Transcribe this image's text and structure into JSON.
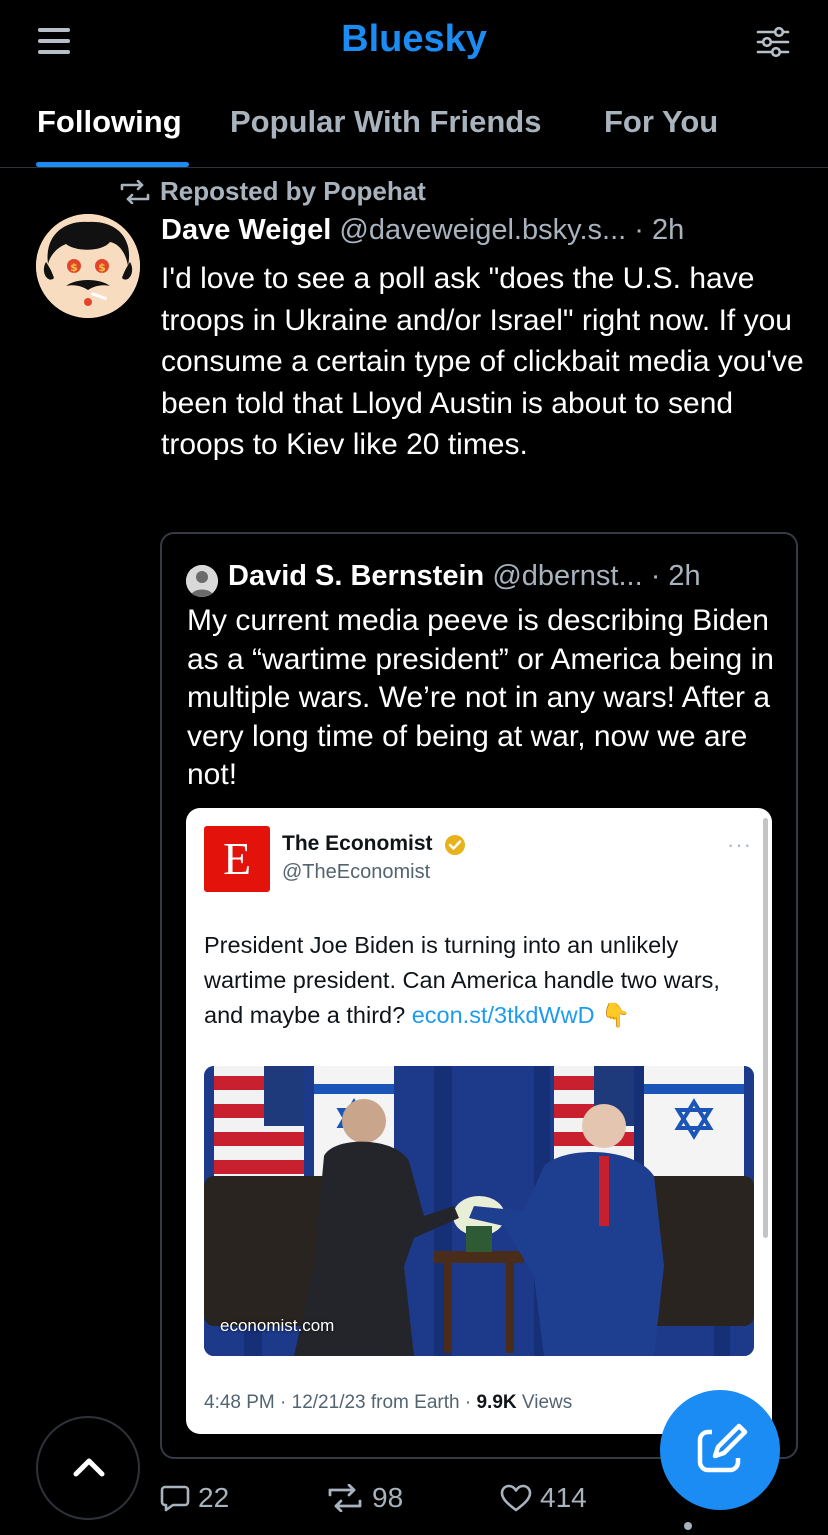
{
  "header": {
    "title": "Bluesky",
    "menu_icon": "hamburger-menu-icon",
    "filter_icon": "sliders-icon"
  },
  "tabs": [
    {
      "label": "Following",
      "active": true
    },
    {
      "label": "Popular With Friends",
      "active": false
    },
    {
      "label": "For You",
      "active": false
    }
  ],
  "post": {
    "repost_label": "Reposted by Popehat",
    "author_name": "Dave Weigel",
    "author_handle": "@daveweigel.bsky.s...",
    "time": "· 2h",
    "text": "I'd love to see a poll ask \"does the U.S. have troops in Ukraine and/or Israel\" right now. If you consume a certain type of clickbait media you've been told that Lloyd Austin is about to send troops to Kiev like 20 times.",
    "quote": {
      "author_name": "David S. Bernstein",
      "author_handle": "@dbernst...",
      "time": "· 2h",
      "text": "My current media peeve is describing Biden as a “wartime president” or America being in multiple wars. We’re not in any wars! After a very long time of being at war, now we are not!",
      "embed": {
        "logo_letter": "E",
        "name": "The Economist",
        "handle": "@TheEconomist",
        "more": "···",
        "text": "President Joe Biden is turning into an unlikely wartime president. Can America handle two wars, and maybe a third?",
        "link": "econ.st/3tkdWwD",
        "emoji": "👇",
        "photo_source": "economist.com",
        "footer_time": "4:48 PM · 12/21/23 from Earth · ",
        "footer_views": "9.9K",
        "footer_views_label": " Views"
      }
    },
    "actions": {
      "replies": "22",
      "reposts": "98",
      "likes": "414"
    }
  },
  "colors": {
    "accent": "#1c8cf5",
    "muted": "#a8b3be",
    "background": "#000000"
  }
}
